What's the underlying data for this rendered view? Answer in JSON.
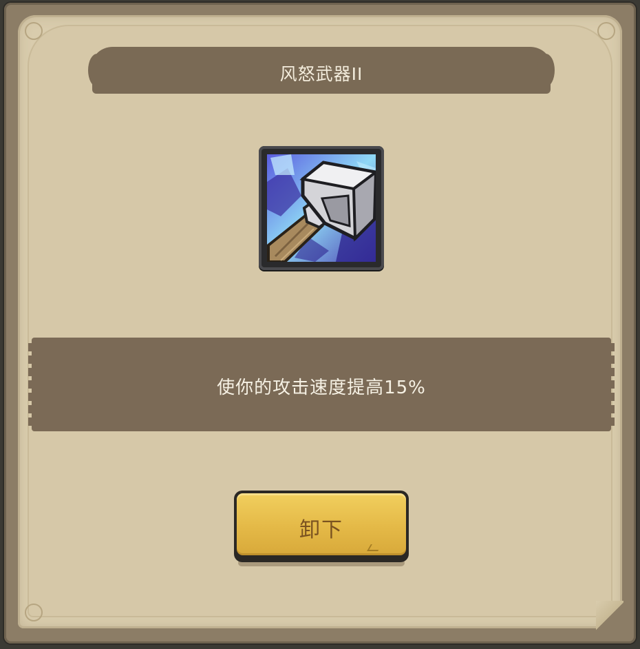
{
  "dialog": {
    "title": "风怒武器II",
    "item_icon": "hammer-icon",
    "description": "使你的攻击速度提高15%",
    "unequip_label": "卸下"
  },
  "colors": {
    "parchment": "#d9ccad",
    "frame": "#8c7d66",
    "banner": "#7a6a55",
    "description_band": "#7b6a56",
    "button": "#e4b947",
    "button_text": "#7a5220"
  }
}
